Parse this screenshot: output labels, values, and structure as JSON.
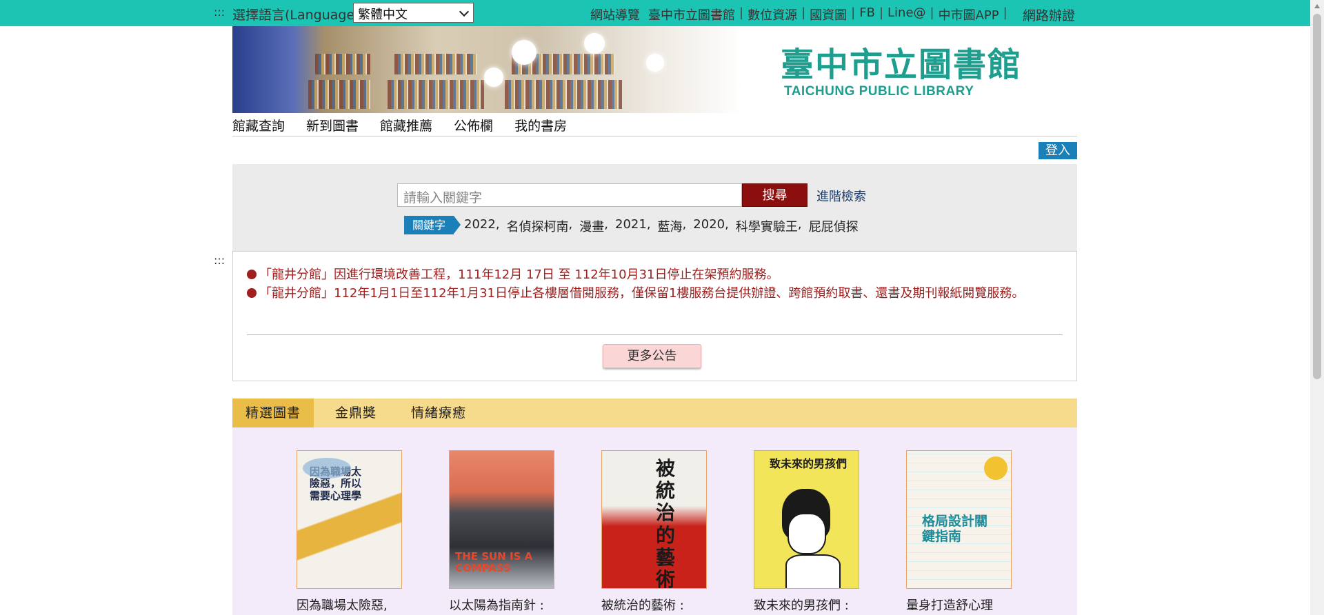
{
  "topbar": {
    "lang_label": "選擇語言(Language) :",
    "lang_selected": "繁體中文",
    "links": [
      "網站導覽",
      "臺中市立圖書館",
      "數位資源",
      "國資圖",
      "FB",
      "Line@",
      "中市圖APP"
    ],
    "register": "網路辦證",
    "bg_color": "#1cc4b4"
  },
  "banner": {
    "logo_cn": "臺中市立圖書館",
    "logo_en": "TAICHUNG PUBLIC LIBRARY"
  },
  "nav": [
    "館藏查詢",
    "新到圖書",
    "館藏推薦",
    "公佈欄",
    "我的書房"
  ],
  "login_label": "登入",
  "search": {
    "placeholder": "請輸入關鍵字",
    "button": "搜尋",
    "advanced": "進階檢索",
    "keyword_badge": "關鍵字",
    "keywords": [
      "2022",
      "名偵探柯南",
      "漫畫",
      "2021",
      "藍海",
      "2020",
      "科學實驗王",
      "屁屁偵探"
    ]
  },
  "announcements": {
    "items": [
      "「龍井分館」因進行環境改善工程，111年12月 17日 至 112年10月31日停止在架預約服務。",
      "「龍井分館」112年1月1日至112年1月31日停止各樓層借閱服務，僅保留1樓服務台提供辦證、跨館預約取書、還書及期刊報紙閱覽服務。"
    ],
    "more_button": "更多公告"
  },
  "tabs": [
    "精選圖書",
    "金鼎獎",
    "情緒療癒"
  ],
  "books": [
    {
      "title": "因為職場太險惡,",
      "cover_text": "因為職場太險惡，所以需要心理學"
    },
    {
      "title": "以太陽為指南針 :",
      "cover_text": "THE SUN IS A COMPASS"
    },
    {
      "title": "被統治的藝術 :",
      "cover_text": "被統治的藝術"
    },
    {
      "title": "致未來的男孩們 :",
      "cover_text": "致未來的男孩們"
    },
    {
      "title": "量身打造舒心理",
      "cover_text": "格局設計關鍵指南"
    }
  ]
}
